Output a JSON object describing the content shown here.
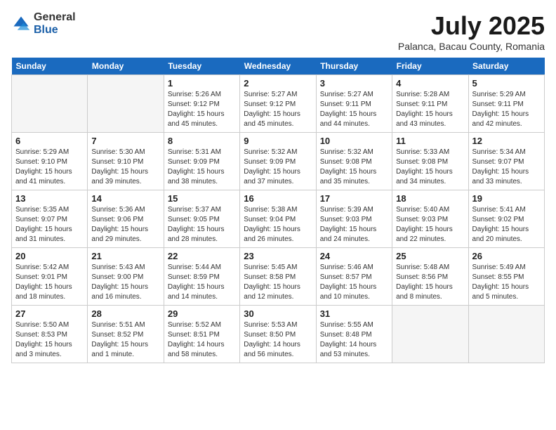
{
  "header": {
    "logo_general": "General",
    "logo_blue": "Blue",
    "month_title": "July 2025",
    "subtitle": "Palanca, Bacau County, Romania"
  },
  "days_of_week": [
    "Sunday",
    "Monday",
    "Tuesday",
    "Wednesday",
    "Thursday",
    "Friday",
    "Saturday"
  ],
  "weeks": [
    [
      {
        "day": "",
        "info": ""
      },
      {
        "day": "",
        "info": ""
      },
      {
        "day": "1",
        "info": "Sunrise: 5:26 AM\nSunset: 9:12 PM\nDaylight: 15 hours\nand 45 minutes."
      },
      {
        "day": "2",
        "info": "Sunrise: 5:27 AM\nSunset: 9:12 PM\nDaylight: 15 hours\nand 45 minutes."
      },
      {
        "day": "3",
        "info": "Sunrise: 5:27 AM\nSunset: 9:11 PM\nDaylight: 15 hours\nand 44 minutes."
      },
      {
        "day": "4",
        "info": "Sunrise: 5:28 AM\nSunset: 9:11 PM\nDaylight: 15 hours\nand 43 minutes."
      },
      {
        "day": "5",
        "info": "Sunrise: 5:29 AM\nSunset: 9:11 PM\nDaylight: 15 hours\nand 42 minutes."
      }
    ],
    [
      {
        "day": "6",
        "info": "Sunrise: 5:29 AM\nSunset: 9:10 PM\nDaylight: 15 hours\nand 41 minutes."
      },
      {
        "day": "7",
        "info": "Sunrise: 5:30 AM\nSunset: 9:10 PM\nDaylight: 15 hours\nand 39 minutes."
      },
      {
        "day": "8",
        "info": "Sunrise: 5:31 AM\nSunset: 9:09 PM\nDaylight: 15 hours\nand 38 minutes."
      },
      {
        "day": "9",
        "info": "Sunrise: 5:32 AM\nSunset: 9:09 PM\nDaylight: 15 hours\nand 37 minutes."
      },
      {
        "day": "10",
        "info": "Sunrise: 5:32 AM\nSunset: 9:08 PM\nDaylight: 15 hours\nand 35 minutes."
      },
      {
        "day": "11",
        "info": "Sunrise: 5:33 AM\nSunset: 9:08 PM\nDaylight: 15 hours\nand 34 minutes."
      },
      {
        "day": "12",
        "info": "Sunrise: 5:34 AM\nSunset: 9:07 PM\nDaylight: 15 hours\nand 33 minutes."
      }
    ],
    [
      {
        "day": "13",
        "info": "Sunrise: 5:35 AM\nSunset: 9:07 PM\nDaylight: 15 hours\nand 31 minutes."
      },
      {
        "day": "14",
        "info": "Sunrise: 5:36 AM\nSunset: 9:06 PM\nDaylight: 15 hours\nand 29 minutes."
      },
      {
        "day": "15",
        "info": "Sunrise: 5:37 AM\nSunset: 9:05 PM\nDaylight: 15 hours\nand 28 minutes."
      },
      {
        "day": "16",
        "info": "Sunrise: 5:38 AM\nSunset: 9:04 PM\nDaylight: 15 hours\nand 26 minutes."
      },
      {
        "day": "17",
        "info": "Sunrise: 5:39 AM\nSunset: 9:03 PM\nDaylight: 15 hours\nand 24 minutes."
      },
      {
        "day": "18",
        "info": "Sunrise: 5:40 AM\nSunset: 9:03 PM\nDaylight: 15 hours\nand 22 minutes."
      },
      {
        "day": "19",
        "info": "Sunrise: 5:41 AM\nSunset: 9:02 PM\nDaylight: 15 hours\nand 20 minutes."
      }
    ],
    [
      {
        "day": "20",
        "info": "Sunrise: 5:42 AM\nSunset: 9:01 PM\nDaylight: 15 hours\nand 18 minutes."
      },
      {
        "day": "21",
        "info": "Sunrise: 5:43 AM\nSunset: 9:00 PM\nDaylight: 15 hours\nand 16 minutes."
      },
      {
        "day": "22",
        "info": "Sunrise: 5:44 AM\nSunset: 8:59 PM\nDaylight: 15 hours\nand 14 minutes."
      },
      {
        "day": "23",
        "info": "Sunrise: 5:45 AM\nSunset: 8:58 PM\nDaylight: 15 hours\nand 12 minutes."
      },
      {
        "day": "24",
        "info": "Sunrise: 5:46 AM\nSunset: 8:57 PM\nDaylight: 15 hours\nand 10 minutes."
      },
      {
        "day": "25",
        "info": "Sunrise: 5:48 AM\nSunset: 8:56 PM\nDaylight: 15 hours\nand 8 minutes."
      },
      {
        "day": "26",
        "info": "Sunrise: 5:49 AM\nSunset: 8:55 PM\nDaylight: 15 hours\nand 5 minutes."
      }
    ],
    [
      {
        "day": "27",
        "info": "Sunrise: 5:50 AM\nSunset: 8:53 PM\nDaylight: 15 hours\nand 3 minutes."
      },
      {
        "day": "28",
        "info": "Sunrise: 5:51 AM\nSunset: 8:52 PM\nDaylight: 15 hours\nand 1 minute."
      },
      {
        "day": "29",
        "info": "Sunrise: 5:52 AM\nSunset: 8:51 PM\nDaylight: 14 hours\nand 58 minutes."
      },
      {
        "day": "30",
        "info": "Sunrise: 5:53 AM\nSunset: 8:50 PM\nDaylight: 14 hours\nand 56 minutes."
      },
      {
        "day": "31",
        "info": "Sunrise: 5:55 AM\nSunset: 8:48 PM\nDaylight: 14 hours\nand 53 minutes."
      },
      {
        "day": "",
        "info": ""
      },
      {
        "day": "",
        "info": ""
      }
    ]
  ]
}
